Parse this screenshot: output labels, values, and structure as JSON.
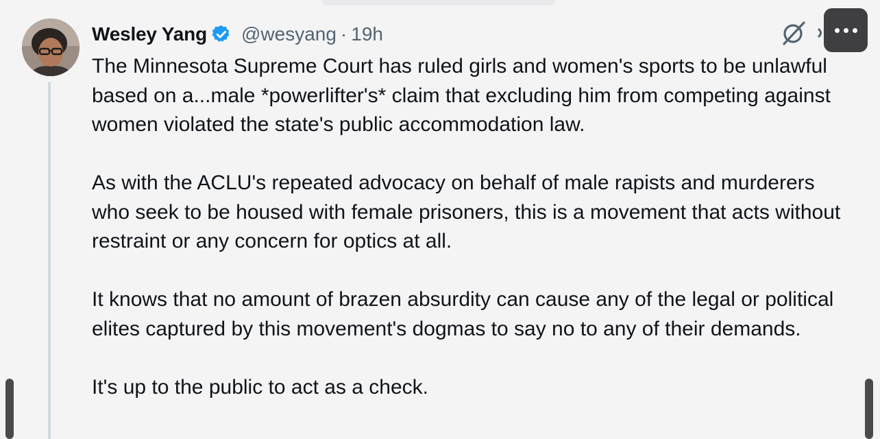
{
  "tweet": {
    "author_name": "Wesley Yang",
    "handle": "@wesyang",
    "separator": "·",
    "time": "19h",
    "paragraphs": [
      "The Minnesota Supreme Court has ruled girls and women's sports to be unlawful based on a...male *powerlifter's* claim that excluding him from competing against women violated the state's public accommodation law.",
      "As with the ACLU's repeated advocacy on behalf of male rapists and murderers who seek to be housed with female prisoners, this is a movement that acts without restraint or any concern for optics at all.",
      "It knows that no amount of brazen absurdity can cause any of the legal or political elites captured by this movement's dogmas to say no to any of their demands.",
      "It's up to the public to act as a check."
    ]
  },
  "icons": {
    "verified": "verified-badge-icon",
    "grok": "grok-icon",
    "more": "more-icon"
  },
  "colors": {
    "background": "#f4f4f5",
    "text": "#0f1419",
    "secondary": "#536471",
    "verified": "#1d9bf0",
    "thread_line": "#cfd9de",
    "more_button_bg": "#3f3f42"
  }
}
